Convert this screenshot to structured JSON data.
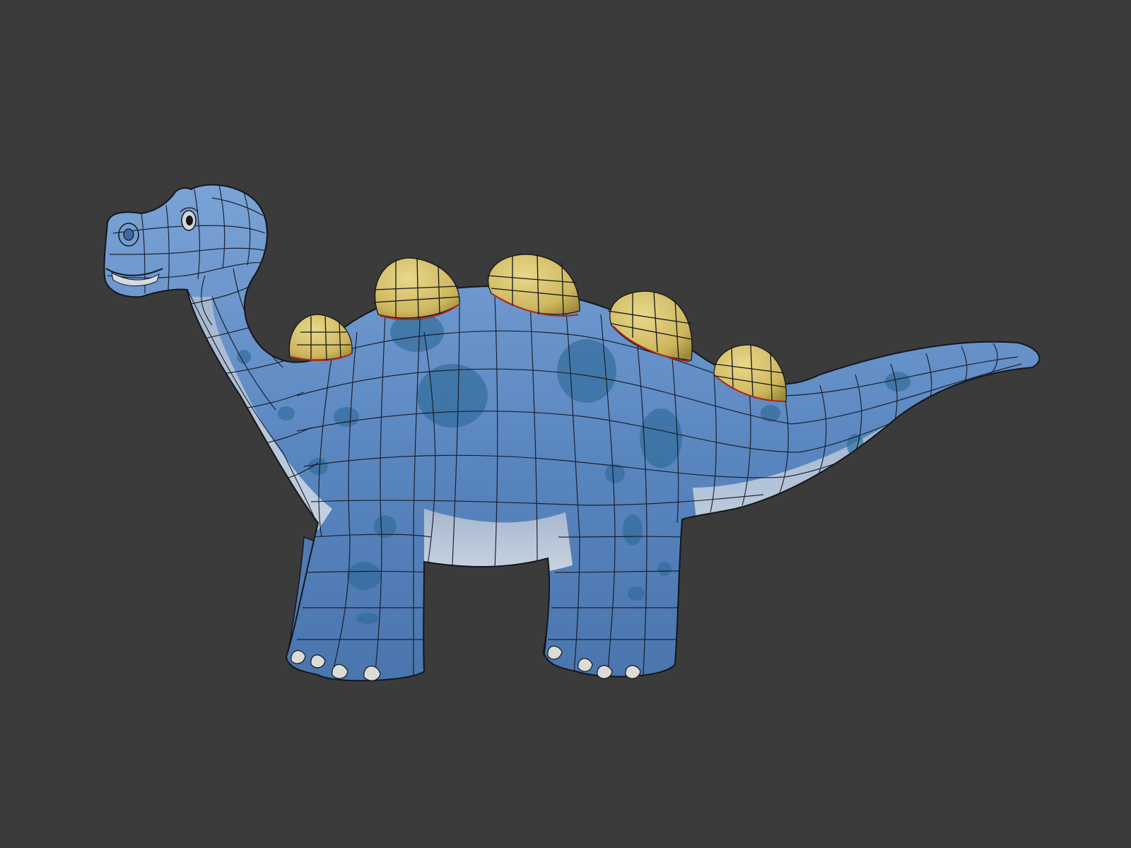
{
  "viewport": {
    "subject": "dinosaur-wireframe-model",
    "background_color": "#3b3b3b",
    "colors": {
      "skin": "#5c88c2",
      "skin_light": "#7fa8da",
      "skin_dark": "#3f6a9f",
      "spots": "#3a73a0",
      "belly": "#c9d3de",
      "plates": "#d6c16e",
      "plates_dark": "#a99440",
      "wire": "#14161c",
      "seam": "#b3261e",
      "nails": "#dcdcd6"
    }
  }
}
